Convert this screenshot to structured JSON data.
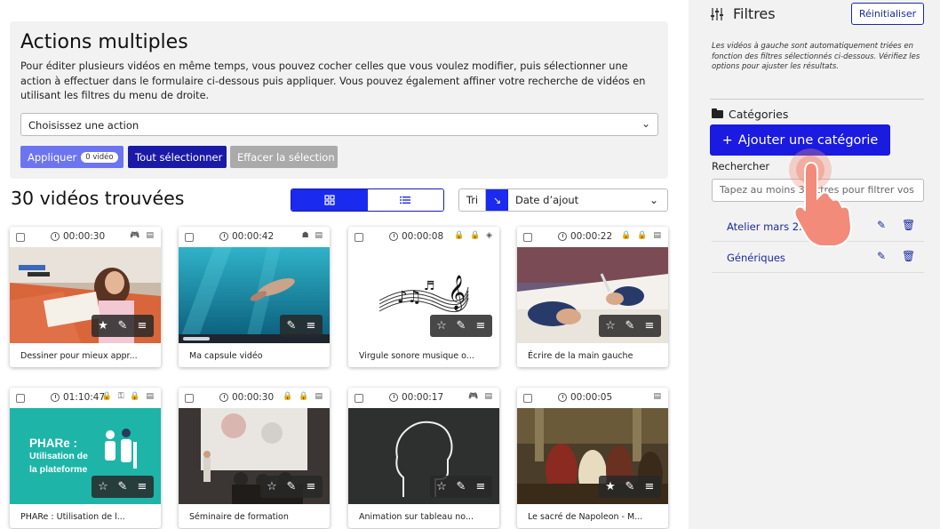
{
  "actions": {
    "title": "Actions multiples",
    "description": "Pour éditer plusieurs vidéos en même temps, vous pouvez cocher celles que vous voulez modifier, puis sélectionner une action à effectuer dans le formulaire ci-dessous puis appliquer. Vous pouvez également affiner votre recherche de vidéos en utilisant les filtres du menu de droite.",
    "select_value": "Choisissez une action",
    "apply_label": "Appliquer",
    "apply_badge": "0 vidéo",
    "select_all_label": "Tout sélectionner",
    "clear_label": "Effacer la sélection"
  },
  "results": {
    "count_label": "30 vidéos trouvées",
    "sort_label": "Tri",
    "sort_value": "Date d’ajout"
  },
  "icons": {
    "grid": "grid-view-icon",
    "list": "list-view-icon",
    "clock": "clock-icon",
    "star": "star-icon",
    "edit": "edit-icon",
    "menu": "menu-icon",
    "trash": "trash-icon",
    "folder": "folder-icon",
    "filters": "sliders-icon"
  },
  "videos": [
    {
      "duration": "00:00:30",
      "title": "Dessiner pour mieux appr...",
      "flags": "🎮 ▤"
    },
    {
      "duration": "00:00:42",
      "title": "Ma capsule vidéo",
      "flags": "☗ ▤"
    },
    {
      "duration": "00:00:08",
      "title": "Virgule sonore musique o...",
      "flags": "🔒 🔒 ◈"
    },
    {
      "duration": "00:00:22",
      "title": "Écrire de la main gauche",
      "flags": "🔒 🔒 ▤"
    },
    {
      "duration": "01:10:47",
      "title": "PHARe : Utilisation de l...",
      "flags": "🔒 ⚿ 🔒 ▤"
    },
    {
      "duration": "00:00:30",
      "title": "Séminaire de formation",
      "flags": "🔒 🔒 ▤"
    },
    {
      "duration": "00:00:17",
      "title": "Animation sur tableau no...",
      "flags": "🎮 ▤"
    },
    {
      "duration": "00:00:05",
      "title": "Le sacré de Napoleon - M...",
      "flags": "▤"
    }
  ],
  "thumb5": {
    "line1": "PHARe :",
    "line2": "Utilisation de",
    "line3": "la plateforme"
  },
  "sidebar": {
    "title": "Filtres",
    "reset_label": "Réinitialiser",
    "note": "Les vidéos à gauche sont automatiquement triées en fonction des filtres sélectionnés ci-dessous. Vérifiez les options pour ajuster les résultats.",
    "categories_title": "Catégories",
    "add_category_label": "Ajouter une catégorie",
    "search_label": "Rechercher",
    "search_placeholder": "Tapez au moins 3 lettres pour filtrer vos",
    "categories": [
      {
        "name": "Atelier mars 2..."
      },
      {
        "name": "Génériques"
      }
    ]
  },
  "colors": {
    "primary": "#1a1ae0",
    "primary_dark": "#1a1aa6",
    "apply": "#6c74f0",
    "disabled": "#aaaaaa",
    "sidebar_bg": "#f2f2f2",
    "pointer_hand": "#f28b7a"
  }
}
